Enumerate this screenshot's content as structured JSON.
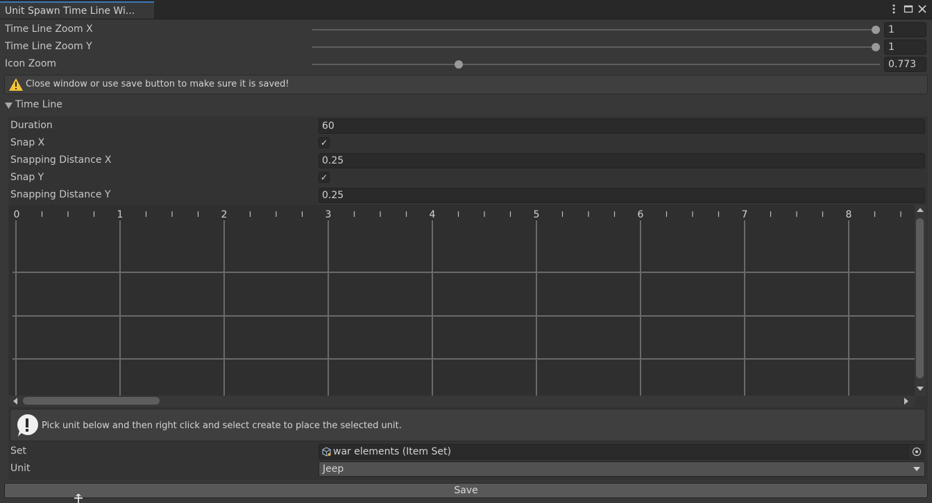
{
  "window": {
    "tab_title": "Unit Spawn Time Line Wi...",
    "menu_icon": "kebab-menu-icon",
    "maximize_icon": "maximize-icon",
    "close_icon": "close-icon"
  },
  "zoom": {
    "x_label": "Time Line Zoom X",
    "x_value": "1",
    "x_fraction": 1.0,
    "y_label": "Time Line Zoom Y",
    "y_value": "1",
    "y_fraction": 1.0,
    "icon_label": "Icon Zoom",
    "icon_value": "0.773",
    "icon_fraction": 0.258
  },
  "warning": {
    "icon": "warning-icon",
    "text": "Close window or use save button to make sure it is saved!"
  },
  "timeline_section": {
    "foldout_label": "Time Line",
    "expanded": true,
    "duration_label": "Duration",
    "duration_value": "60",
    "snap_x_label": "Snap X",
    "snap_x_checked": true,
    "snap_dist_x_label": "Snapping Distance X",
    "snap_dist_x_value": "0.25",
    "snap_y_label": "Snap Y",
    "snap_y_checked": true,
    "snap_dist_y_label": "Snapping Distance Y",
    "snap_dist_y_value": "0.25",
    "ruler_labels": [
      "0",
      "1",
      "2",
      "3",
      "4",
      "5",
      "6",
      "7",
      "8"
    ],
    "check_glyph": "✓"
  },
  "info": {
    "icon": "info-icon",
    "text": "Pick unit below and then right click and select create to place the selected unit."
  },
  "selection": {
    "set_label": "Set",
    "set_value": "war elements (Item Set)",
    "unit_label": "Unit",
    "unit_value": "Jeep"
  },
  "footer": {
    "save_label": "Save"
  }
}
